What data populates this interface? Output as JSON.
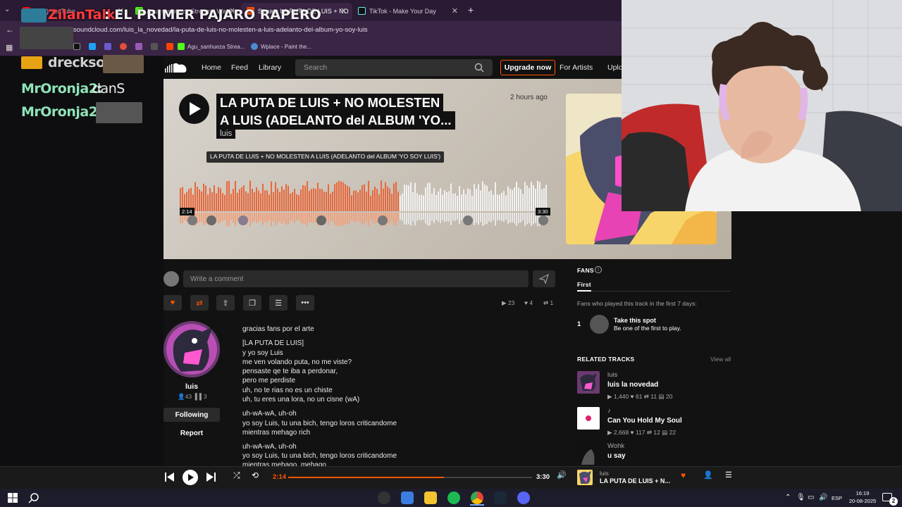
{
  "browser": {
    "tabs": [
      {
        "label": "(389) YouTube",
        "color": "#ff0000"
      },
      {
        "label": "Agu_sanhueza Stream - Watch",
        "color": "#53fc18"
      },
      {
        "label": "Stream LA PUTA DE LUIS + NO",
        "color": "#ff5500"
      },
      {
        "label": "TikTok - Make Your Day",
        "color": "#111111"
      }
    ],
    "new_tab": "+",
    "url": "soundcloud.com/luis_la_novedad/la-puta-de-luis-no-molesten-a-luis-adelanto-del-album-yo-soy-luis",
    "bookmarks": [
      {
        "label": "Agu_sanhueza Strea..."
      },
      {
        "label": "Wplace - Paint the..."
      }
    ]
  },
  "stream_overlay": {
    "top_user": "ZilanTalk",
    "top_message": ": EL PRIMER PAJARO RAPERO",
    "chat": [
      {
        "user": "dreckso:",
        "msg": "",
        "color": "#cfcfcf"
      },
      {
        "user": "MrOronja2:",
        "msg": " danS",
        "color": "#8fe3b7"
      },
      {
        "user": "MrOronja2:",
        "msg": "",
        "color": "#8fe3b7"
      }
    ]
  },
  "header": {
    "nav": [
      "Home",
      "Feed",
      "Library"
    ],
    "search_placeholder": "Search",
    "upgrade": "Upgrade now",
    "for_artists": "For Artists",
    "upload": "Upload"
  },
  "track": {
    "title_line1": "LA PUTA DE LUIS + NO MOLESTEN",
    "title_line2": "A LUIS (ADELANTO del ALBUM 'YO...",
    "artist": "luis",
    "posted": "2 hours ago",
    "tooltip": "LA PUTA DE LUIS + NO MOLESTEN A LUIS (ADELANTO del ALBUM 'YO SOY LUIS')",
    "current_time": "2:14",
    "duration": "3:30",
    "progress": 0.638
  },
  "comment": {
    "placeholder": "Write a comment"
  },
  "stats": {
    "plays": "23",
    "likes": "4",
    "reposts": "1"
  },
  "artist": {
    "name": "luis",
    "followers": "43",
    "tracks": "3",
    "following_btn": "Following",
    "report": "Report"
  },
  "description": [
    "gracias fans por el arte",
    "[LA PUTA DE LUIS]",
    "y yo soy Luis",
    "me ven volando puta, no me viste?",
    "pensaste qe te iba a perdonar,",
    "pero me perdiste",
    "uh, no te rias no es un chiste",
    "uh, tu eres una lora, no un cisne (wA)",
    "uh-wA-wA, uh-oh",
    "yo soy Luis, tu una bich, tengo loros criticandome",
    "mientras mehago rich",
    "uh-wA-wA, uh-oh",
    "yo soy Luis, tu una bich, tengo loros criticandome",
    "mientras mehago, mehago"
  ],
  "fans": {
    "heading": "FANS",
    "tab": "First",
    "subtitle": "Fans who played this track in the first 7 days:",
    "rank": "1",
    "spot_title": "Take this spot",
    "spot_sub": "Be one of the first to play."
  },
  "related": {
    "heading": "RELATED TRACKS",
    "view_all": "View all",
    "items": [
      {
        "artist": "luis",
        "title": "luis la novedad",
        "plays": "1,440",
        "likes": "61",
        "reposts": "11",
        "comments": "20"
      },
      {
        "artist": "♪",
        "title": "Can You Hold My Soul",
        "plays": "2,668",
        "likes": "117",
        "reposts": "12",
        "comments": "22"
      },
      {
        "artist": "Wohk",
        "title": "u say",
        "plays": "",
        "likes": "",
        "reposts": "",
        "comments": ""
      }
    ]
  },
  "player": {
    "current": "2:14",
    "total": "3:30",
    "artist": "luis",
    "title": "LA PUTA DE LUIS + N..."
  },
  "taskbar": {
    "lang": "ESP",
    "time": "16:19",
    "date": "20-08-2025",
    "notif": "2"
  },
  "colors": {
    "accent": "#ff5500",
    "played": "#e8673a",
    "unplayed": "#f2f2f2"
  }
}
